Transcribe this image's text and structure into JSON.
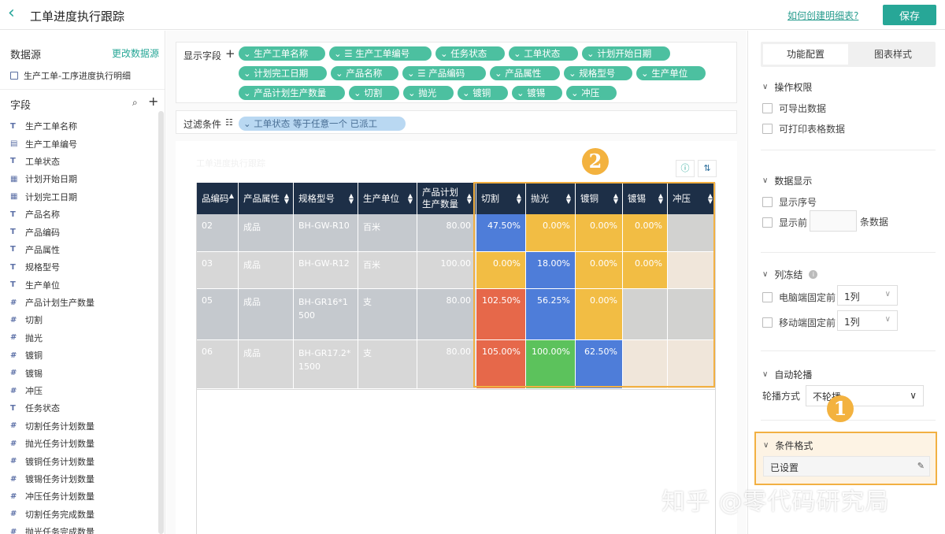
{
  "header": {
    "back_icon": "chevron-left-icon",
    "title": "工单进度执行跟踪",
    "help_link": "如何创建明细表?",
    "save_label": "保存"
  },
  "left_panel": {
    "datasource_title": "数据源",
    "datasource_change": "更改数据源",
    "datasource_item": "生产工单-工序进度执行明细",
    "fields_title": "字段",
    "fields": [
      {
        "type": "T",
        "label": "生产工单名称"
      },
      {
        "type": "▤",
        "label": "生产工单编号"
      },
      {
        "type": "T",
        "label": "工单状态"
      },
      {
        "type": "▦",
        "label": "计划开始日期"
      },
      {
        "type": "▦",
        "label": "计划完工日期"
      },
      {
        "type": "T",
        "label": "产品名称"
      },
      {
        "type": "T",
        "label": "产品编码"
      },
      {
        "type": "T",
        "label": "产品属性"
      },
      {
        "type": "T",
        "label": "规格型号"
      },
      {
        "type": "T",
        "label": "生产单位"
      },
      {
        "type": "#",
        "label": "产品计划生产数量"
      },
      {
        "type": "#",
        "label": "切割"
      },
      {
        "type": "#",
        "label": "抛光"
      },
      {
        "type": "#",
        "label": "镀铜"
      },
      {
        "type": "#",
        "label": "镀锡"
      },
      {
        "type": "#",
        "label": "冲压"
      },
      {
        "type": "T",
        "label": "任务状态"
      },
      {
        "type": "#",
        "label": "切割任务计划数量"
      },
      {
        "type": "#",
        "label": "抛光任务计划数量"
      },
      {
        "type": "#",
        "label": "镀铜任务计划数量"
      },
      {
        "type": "#",
        "label": "镀锡任务计划数量"
      },
      {
        "type": "#",
        "label": "冲压任务计划数量"
      },
      {
        "type": "#",
        "label": "切割任务完成数量"
      },
      {
        "type": "#",
        "label": "抛光任务完成数量"
      }
    ]
  },
  "center": {
    "show_fields_label": "显示字段",
    "show_fields": [
      "生产工单名称",
      "生产工单编号",
      "任务状态",
      "工单状态",
      "计划开始日期",
      "计划完工日期",
      "产品名称",
      "产品编码",
      "产品属性",
      "规格型号",
      "生产单位",
      "产品计划生产数量",
      "切割",
      "抛光",
      "镀铜",
      "镀锡",
      "冲压"
    ],
    "filter_label": "过滤条件",
    "filter_chip": "工单状态 等于任意一个 已派工",
    "chart_title": "工单进度执行跟踪",
    "table": {
      "headers": [
        "品编码",
        "产品属性",
        "规格型号",
        "生产单位",
        "产品计划生产数量",
        "切割",
        "抛光",
        "镀铜",
        "镀锡",
        "冲压"
      ],
      "rows": [
        {
          "code": "02",
          "attr": "成品",
          "spec": "BH-GW-R10",
          "unit": "百米",
          "qty": "80.00",
          "cut": "47.50%",
          "polish": "0.00%",
          "copper": "0.00%",
          "tin": "0.00%",
          "stamp": ""
        },
        {
          "code": "03",
          "attr": "成品",
          "spec": "BH-GW-R12",
          "unit": "百米",
          "qty": "100.00",
          "cut": "0.00%",
          "polish": "18.00%",
          "copper": "0.00%",
          "tin": "0.00%",
          "stamp": ""
        },
        {
          "code": "05",
          "attr": "成品",
          "spec": "BH-GR16*1500",
          "unit": "支",
          "qty": "80.00",
          "cut": "102.50%",
          "polish": "56.25%",
          "copper": "0.00%",
          "tin": "",
          "stamp": ""
        },
        {
          "code": "06",
          "attr": "成品",
          "spec": "BH-GR17.2*1500",
          "unit": "支",
          "qty": "80.00",
          "cut": "105.00%",
          "polish": "100.00%",
          "copper": "62.50%",
          "tin": "",
          "stamp": ""
        }
      ]
    },
    "badges": [
      "2",
      "1"
    ]
  },
  "right_panel": {
    "tab_active": "功能配置",
    "tab_inactive": "图表样式",
    "permissions_title": "操作权限",
    "perm_export": "可导出数据",
    "perm_print": "可打印表格数据",
    "display_title": "数据显示",
    "display_index": "显示序号",
    "display_top": "显示前",
    "display_top_suffix": "条数据",
    "freeze_title": "列冻结",
    "freeze_pc": "电脑端固定前",
    "freeze_pc_value": "1列",
    "freeze_mobile": "移动端固定前",
    "freeze_mobile_value": "1列",
    "carousel_title": "自动轮播",
    "carousel_mode_label": "轮播方式",
    "carousel_mode_value": "不轮播",
    "cond_title": "条件格式",
    "cond_value": "已设置"
  },
  "watermark": "知乎 @零代码研究局"
}
